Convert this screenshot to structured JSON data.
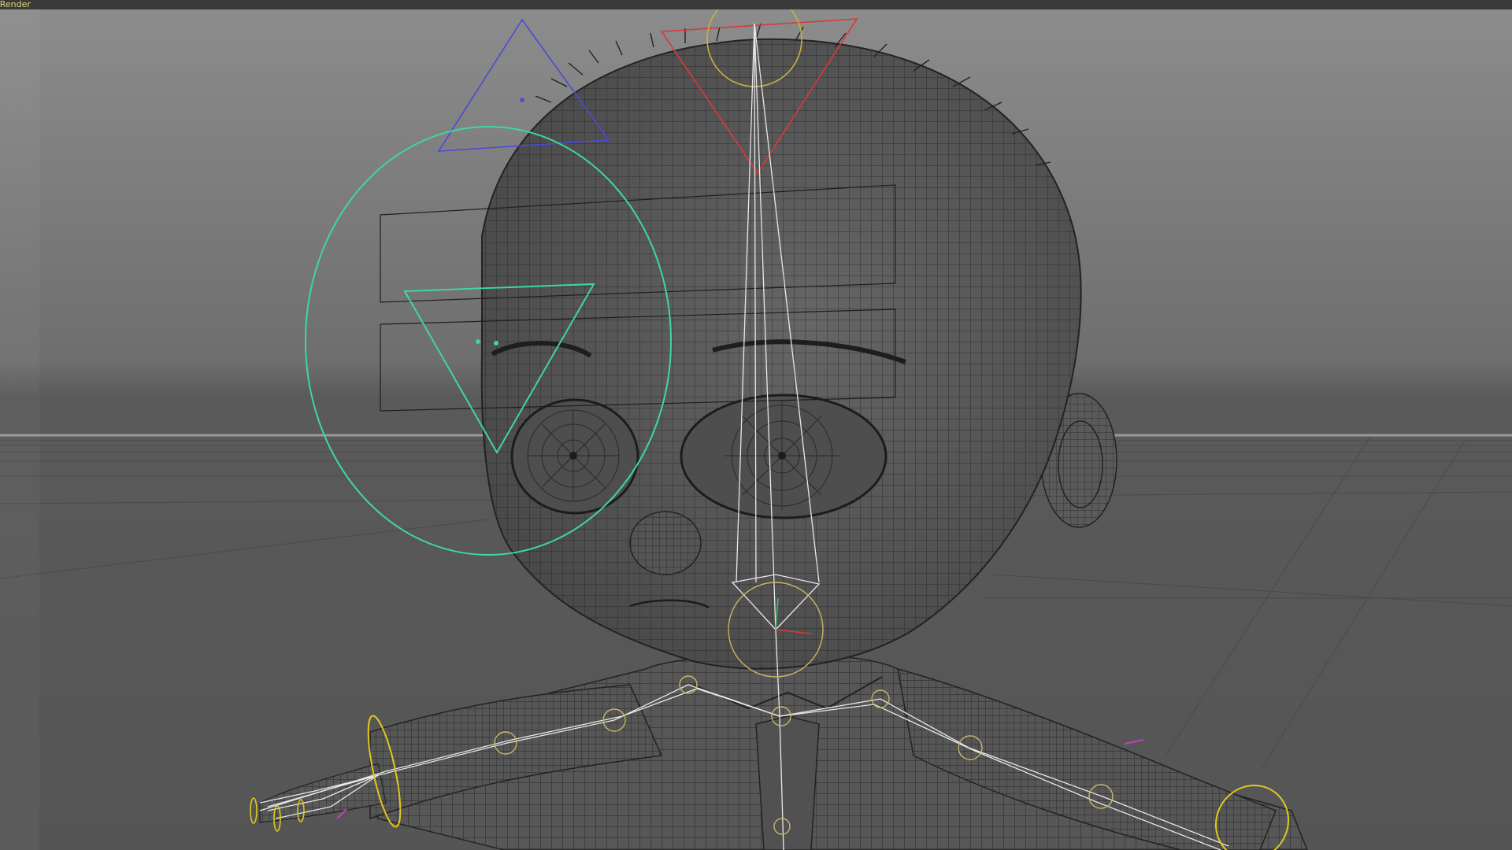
{
  "window": {
    "title_fragment": "oRender"
  },
  "viewport": {
    "background_top": "#8a8a8a",
    "background_horizon": "#6a6a6a",
    "floor_color": "#5e5e5e",
    "mesh_fill": "#585858",
    "mesh_line": "#202020",
    "skeleton_color": "#e8e8e8",
    "joint_color": "#c9b56a",
    "controllers": [
      {
        "name": "eye-look-controller",
        "shape": "circle",
        "color": "#3fd6a2"
      },
      {
        "name": "eye-target-triangle",
        "shape": "triangle",
        "color": "#3fd6a2"
      },
      {
        "name": "light-triangle-blue",
        "shape": "triangle",
        "color": "#4a4ad8"
      },
      {
        "name": "head-top-triangle-red",
        "shape": "triangle",
        "color": "#d83a3a"
      },
      {
        "name": "head-top-ring",
        "shape": "circle",
        "color": "#c9b040"
      },
      {
        "name": "neck-ring",
        "shape": "circle",
        "color": "#c9b56a"
      },
      {
        "name": "right-wrist-ring",
        "shape": "ellipse",
        "color": "#e0c820"
      },
      {
        "name": "left-wrist-ring",
        "shape": "ellipse",
        "color": "#e0c820"
      }
    ]
  }
}
